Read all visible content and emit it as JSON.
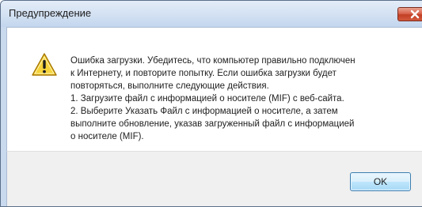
{
  "dialog": {
    "title": "Предупреждение",
    "close_icon": "close-icon",
    "warning_icon": "warning-icon",
    "message_paragraphs": [
      {
        "lines": [
          "Ошибка загрузки. Убедитесь, что компьютер правильно подключен",
          "к Интернету, и повторите попытку. Если ошибка загрузки будет",
          "повторяться, выполните следующие действия."
        ]
      },
      {
        "lines": [
          "1. Загрузите файл с информацией о носителе (MIF) с веб-сайта."
        ]
      },
      {
        "lines": [
          "2. Выберите Указать Файл с информацией о носителе, а затем",
          "выполните обновление, указав загруженный файл с информацией",
          "о носителе (MIF)."
        ]
      }
    ],
    "ok_label": "OK"
  },
  "colors": {
    "titlebar": "#d4e2f3",
    "close_button": "#c8442a",
    "warning_fill": "#f5d33b",
    "ok_border": "#3c7fb1"
  }
}
